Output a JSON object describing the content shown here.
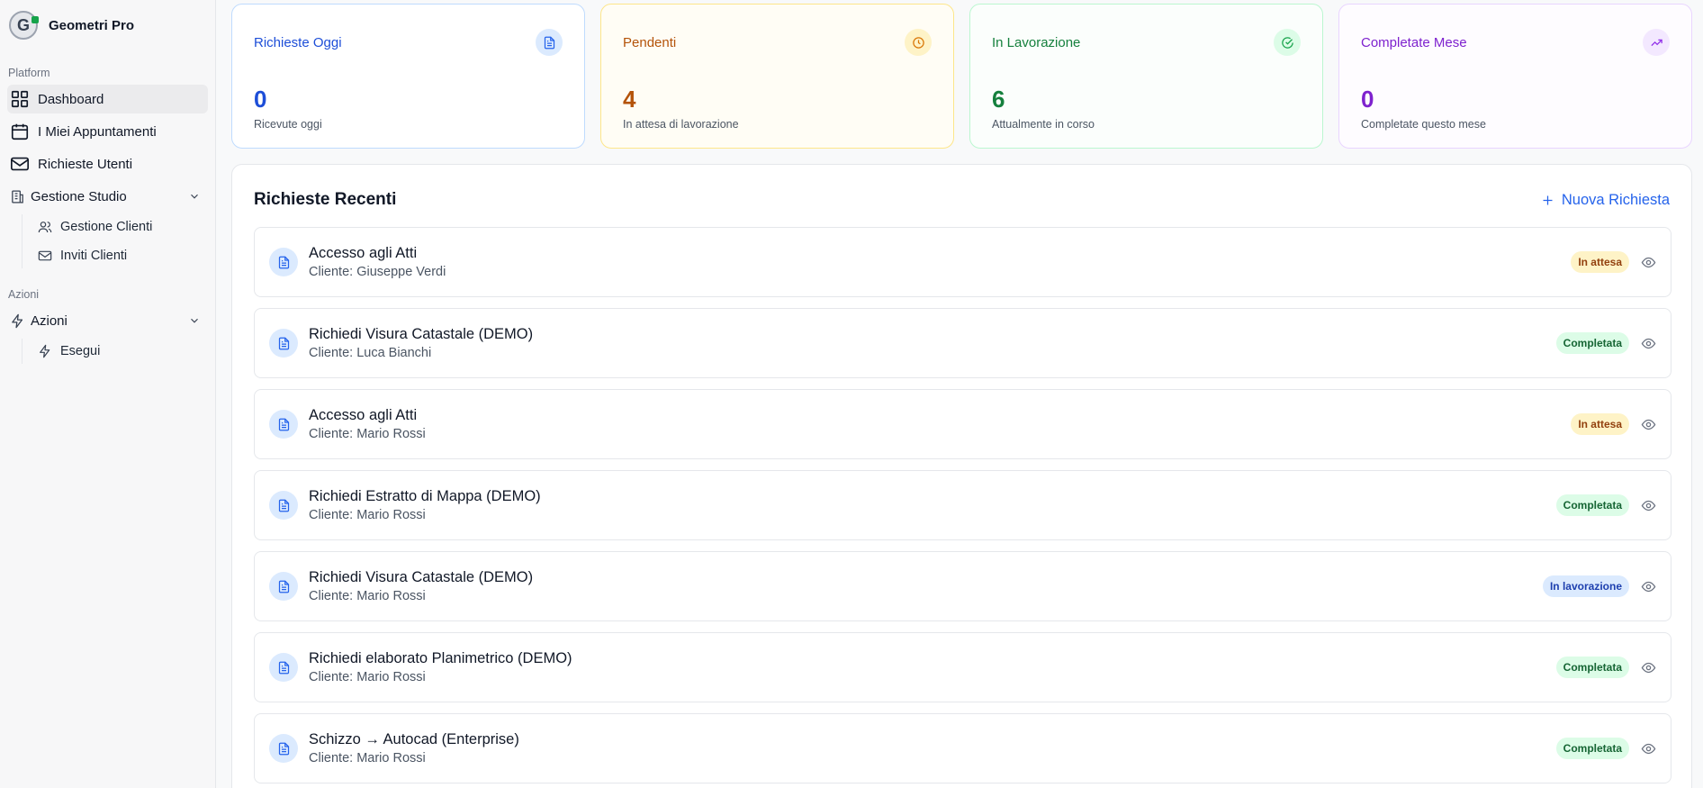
{
  "brand": {
    "name": "Geometri Pro",
    "logo_letter": "G"
  },
  "sidebar": {
    "platform_label": "Platform",
    "items": [
      {
        "label": "Dashboard",
        "icon": "dashboard-icon"
      },
      {
        "label": "I Miei Appuntamenti",
        "icon": "calendar-icon"
      },
      {
        "label": "Richieste Utenti",
        "icon": "mail-icon"
      }
    ],
    "gestione": {
      "label": "Gestione Studio",
      "children": [
        {
          "label": "Gestione Clienti",
          "icon": "users-icon"
        },
        {
          "label": "Inviti Clienti",
          "icon": "mail-icon"
        }
      ]
    },
    "azioni_label": "Azioni",
    "azioni": {
      "label": "Azioni",
      "children": [
        {
          "label": "Esegui",
          "icon": "bolt-icon"
        }
      ]
    }
  },
  "stats": [
    {
      "title": "Richieste Oggi",
      "value": "0",
      "desc": "Ricevute oggi",
      "color": "#1d4ed8",
      "icon": "file-icon"
    },
    {
      "title": "Pendenti",
      "value": "4",
      "desc": "In attesa di lavorazione",
      "color": "#b45309",
      "icon": "clock-icon"
    },
    {
      "title": "In Lavorazione",
      "value": "6",
      "desc": "Attualmente in corso",
      "color": "#15803d",
      "icon": "check-circle-icon"
    },
    {
      "title": "Completate Mese",
      "value": "0",
      "desc": "Completate questo mese",
      "color": "#7e22ce",
      "icon": "trend-up-icon"
    }
  ],
  "recent": {
    "title": "Richieste Recenti",
    "new_button": "Nuova Richiesta",
    "items": [
      {
        "title": "Accesso agli Atti",
        "client": "Cliente: Giuseppe Verdi",
        "status": "In attesa",
        "status_type": "pending"
      },
      {
        "title": "Richiedi Visura Catastale (DEMO)",
        "client": "Cliente: Luca Bianchi",
        "status": "Completata",
        "status_type": "done"
      },
      {
        "title": "Accesso agli Atti",
        "client": "Cliente: Mario Rossi",
        "status": "In attesa",
        "status_type": "pending"
      },
      {
        "title": "Richiedi Estratto di Mappa (DEMO)",
        "client": "Cliente: Mario Rossi",
        "status": "Completata",
        "status_type": "done"
      },
      {
        "title": "Richiedi Visura Catastale (DEMO)",
        "client": "Cliente: Mario Rossi",
        "status": "In lavorazione",
        "status_type": "work"
      },
      {
        "title": "Richiedi elaborato Planimetrico (DEMO)",
        "client": "Cliente: Mario Rossi",
        "status": "Completata",
        "status_type": "done"
      },
      {
        "title": "Schizzo → Autocad (Enterprise)",
        "client": "Cliente: Mario Rossi",
        "status": "Completata",
        "status_type": "done"
      }
    ]
  }
}
